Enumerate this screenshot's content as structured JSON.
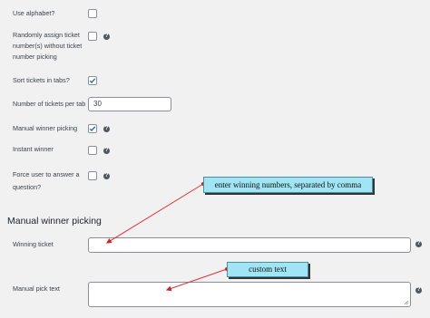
{
  "settings": {
    "use_alphabet": {
      "label": "Use alphabet?",
      "checked": false
    },
    "random_assign": {
      "label_line1": "Randomly assign ticket",
      "label_line2": "number(s) without ticket",
      "label_line3": "number picking",
      "checked": false
    },
    "sort_tabs": {
      "label": "Sort tickets in tabs?",
      "checked": true
    },
    "tickets_per_tab": {
      "label": "Number of tickets per tab",
      "value": "30"
    },
    "manual_winner": {
      "label": "Manual winner picking",
      "checked": true
    },
    "instant_winner": {
      "label": "Instant winner",
      "checked": false
    },
    "force_answer": {
      "label_line1": "Force user to answer a",
      "label_line2": "question?",
      "checked": false
    }
  },
  "manual_section": {
    "title": "Manual winner picking",
    "winning_ticket": {
      "label": "Winning ticket",
      "value": ""
    },
    "manual_pick_text": {
      "label": "Manual pick text",
      "value": ""
    }
  },
  "callouts": {
    "winning": "enter winning numbers, separated by comma",
    "custom": "custom text"
  },
  "colors": {
    "checkbox_check": "#2271b1",
    "arrow": "#e0303a",
    "callout_bg": "#9fe5f4"
  },
  "icons": {
    "help": "question-mark-circle-icon"
  }
}
